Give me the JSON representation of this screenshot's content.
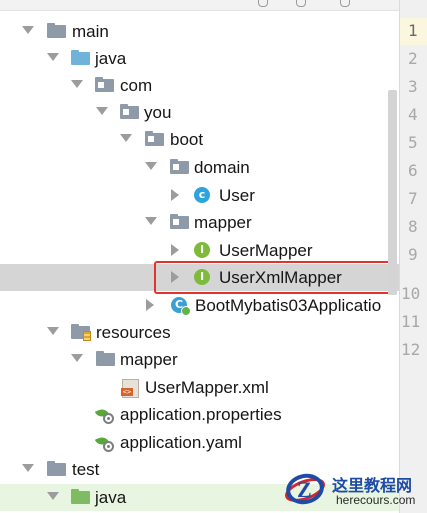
{
  "tree": {
    "items": [
      {
        "label": "main",
        "type": "folder-grey",
        "expanded": true,
        "selected": false
      },
      {
        "label": "java",
        "type": "folder-blue",
        "expanded": true,
        "selected": false
      },
      {
        "label": "com",
        "type": "package",
        "expanded": true,
        "selected": false
      },
      {
        "label": "you",
        "type": "package",
        "expanded": true,
        "selected": false
      },
      {
        "label": "boot",
        "type": "package",
        "expanded": true,
        "selected": false
      },
      {
        "label": "domain",
        "type": "package",
        "expanded": true,
        "selected": false
      },
      {
        "label": "User",
        "type": "class",
        "icon_letter": "c",
        "expanded": false,
        "selected": false
      },
      {
        "label": "mapper",
        "type": "package",
        "expanded": true,
        "selected": false
      },
      {
        "label": "UserMapper",
        "type": "interface",
        "icon_letter": "I",
        "expanded": false,
        "selected": false
      },
      {
        "label": "UserXmlMapper",
        "type": "interface",
        "icon_letter": "I",
        "expanded": false,
        "selected": true,
        "highlighted": true
      },
      {
        "label": "BootMybatis03Applicatio",
        "type": "spring-boot-class",
        "icon_letter": "C",
        "expanded": false,
        "selected": false
      },
      {
        "label": "resources",
        "type": "folder-resources",
        "expanded": true,
        "selected": false
      },
      {
        "label": "mapper",
        "type": "folder-grey",
        "expanded": true,
        "selected": false
      },
      {
        "label": "UserMapper.xml",
        "type": "xml-file",
        "icon_tag": "<>",
        "selected": false
      },
      {
        "label": "application.properties",
        "type": "spring-config",
        "selected": false
      },
      {
        "label": "application.yaml",
        "type": "spring-config",
        "selected": false
      },
      {
        "label": "test",
        "type": "folder-grey",
        "expanded": true,
        "selected": false
      },
      {
        "label": "java",
        "type": "folder-green",
        "expanded": true,
        "selected": false
      }
    ]
  },
  "gutter": {
    "line_numbers": [
      "1",
      "2",
      "3",
      "4",
      "5",
      "6",
      "7",
      "8",
      "9",
      "10",
      "11",
      "12"
    ],
    "current_line": "1"
  },
  "watermark": {
    "cn_text": "这里教程网",
    "en_text": "herecours.com",
    "logo_letter": "Z"
  },
  "colors": {
    "highlight_border": "#e0342c",
    "selected_row": "#d5d5d5",
    "interface_icon": "#7fbb3a",
    "class_icon": "#2fa3dd"
  }
}
